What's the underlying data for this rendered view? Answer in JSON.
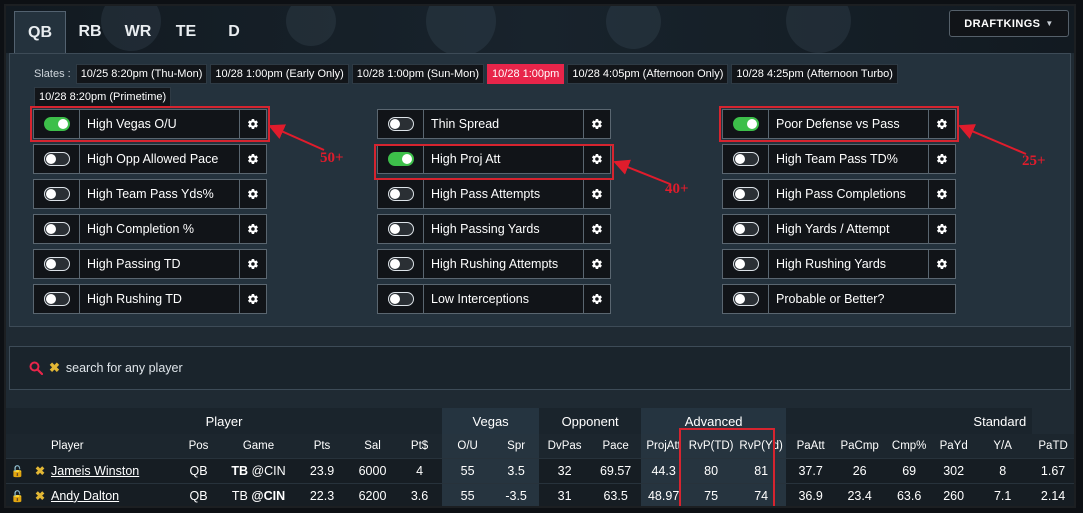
{
  "header": {
    "tabs": [
      {
        "label": "QB",
        "active": true
      },
      {
        "label": "RB",
        "active": false
      },
      {
        "label": "WR",
        "active": false
      },
      {
        "label": "TE",
        "active": false
      },
      {
        "label": "D",
        "active": false
      }
    ],
    "site": "DRAFTKINGS"
  },
  "slates": {
    "label": "Slates :",
    "items": [
      {
        "label": "10/25 8:20pm (Thu-Mon)",
        "active": false
      },
      {
        "label": "10/28 1:00pm (Early Only)",
        "active": false
      },
      {
        "label": "10/28 1:00pm (Sun-Mon)",
        "active": false
      },
      {
        "label": "10/28 1:00pm",
        "active": true
      },
      {
        "label": "10/28 4:05pm (Afternoon Only)",
        "active": false
      },
      {
        "label": "10/28 4:25pm (Afternoon Turbo)",
        "active": false
      },
      {
        "label": "10/28 8:20pm (Primetime)",
        "active": false
      }
    ]
  },
  "filters": {
    "col1": [
      {
        "label": "High Vegas O/U",
        "on": true
      },
      {
        "label": "High Opp Allowed Pace",
        "on": false
      },
      {
        "label": "High Team Pass Yds%",
        "on": false
      },
      {
        "label": "High Completion %",
        "on": false
      },
      {
        "label": "High Passing TD",
        "on": false
      },
      {
        "label": "High Rushing TD",
        "on": false
      }
    ],
    "col2": [
      {
        "label": "Thin Spread",
        "on": false
      },
      {
        "label": "High Proj Att",
        "on": true
      },
      {
        "label": "High Pass Attempts",
        "on": false
      },
      {
        "label": "High Passing Yards",
        "on": false
      },
      {
        "label": "High Rushing Attempts",
        "on": false
      },
      {
        "label": "Low Interceptions",
        "on": false
      }
    ],
    "col3": [
      {
        "label": "Poor Defense vs Pass",
        "on": true
      },
      {
        "label": "High Team Pass TD%",
        "on": false
      },
      {
        "label": "High Pass Completions",
        "on": false
      },
      {
        "label": "High Yards / Attempt",
        "on": false
      },
      {
        "label": "High Rushing Yards",
        "on": false
      },
      {
        "label": "Probable or Better?",
        "on": false
      }
    ]
  },
  "annotations": {
    "a1": "50+",
    "a2": "40+",
    "a3": "25+",
    "color": "#e01c2c"
  },
  "search": {
    "placeholder": "search for any player"
  },
  "table": {
    "groups": {
      "player": "Player",
      "vegas": "Vegas",
      "opponent": "Opponent",
      "advanced": "Advanced",
      "standard": "Standard"
    },
    "columns": [
      "Player",
      "Pos",
      "Game",
      "Pts",
      "Sal",
      "Pt$",
      "O/U",
      "Spr",
      "DvPas",
      "Pace",
      "ProjAtt",
      "RvP(TD)",
      "RvP(Yd)",
      "PaAtt",
      "PaCmp",
      "Cmp%",
      "PaYd",
      "Y/A",
      "PaTD"
    ],
    "rows": [
      {
        "player": "Jameis Winston",
        "pos": "QB",
        "team": "TB",
        "opp": "@CIN",
        "bold": "team",
        "pts": "23.9",
        "sal": "6000",
        "ptd": "4",
        "ou": "55",
        "spr": "3.5",
        "dvpas": "32",
        "pace": "69.57",
        "projatt": "44.3",
        "rvptd": "80",
        "rvpyd": "81",
        "paatt": "37.7",
        "pacmp": "26",
        "cmp": "69",
        "payd": "302",
        "ya": "8",
        "patd": "1.67"
      },
      {
        "player": "Andy Dalton",
        "pos": "QB",
        "team": "TB",
        "opp": "@CIN",
        "bold": "opp",
        "pts": "22.3",
        "sal": "6200",
        "ptd": "3.6",
        "ou": "55",
        "spr": "-3.5",
        "dvpas": "31",
        "pace": "63.5",
        "projatt": "48.97",
        "rvptd": "75",
        "rvpyd": "74",
        "paatt": "36.9",
        "pacmp": "23.4",
        "cmp": "63.6",
        "payd": "260",
        "ya": "7.1",
        "patd": "2.14"
      }
    ]
  },
  "colors": {
    "accent": "#e8254a",
    "toggle_on": "#3dbf4a",
    "highlight": "#d6242f",
    "panel": "#24323d"
  }
}
